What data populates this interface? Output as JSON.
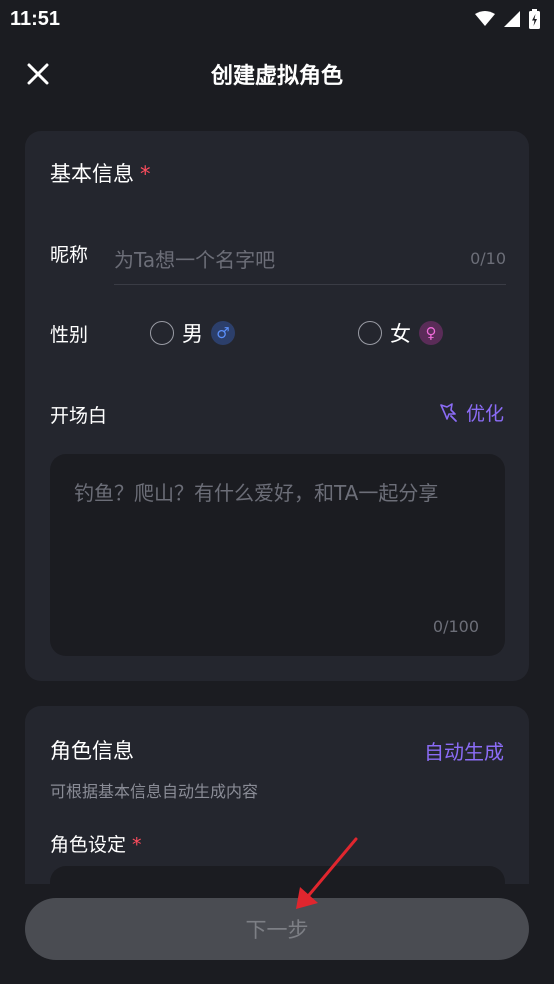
{
  "status_bar": {
    "time": "11:51",
    "icons": [
      "wifi-icon",
      "signal-icon",
      "battery-charging-icon"
    ]
  },
  "header": {
    "title": "创建虚拟角色",
    "close_icon": "close-icon"
  },
  "basic_info": {
    "title": "基本信息",
    "required_mark": "*",
    "nickname": {
      "label": "昵称",
      "placeholder": "为Ta想一个名字吧",
      "counter": "0/10"
    },
    "gender": {
      "label": "性别",
      "male_label": "男",
      "male_symbol": "♂",
      "female_label": "女",
      "female_symbol": "♀"
    },
    "opening": {
      "label": "开场白",
      "optimize_label": "优化",
      "optimize_icon": "magic-wand-icon",
      "placeholder": "钓鱼？爬山？有什么爱好，和TA一起分享",
      "counter": "0/100"
    }
  },
  "role_info": {
    "title": "角色信息",
    "auto_generate_label": "自动生成",
    "hint": "可根据基本信息自动生成内容",
    "setting_label": "角色设定",
    "required_mark": "*"
  },
  "footer": {
    "next_label": "下一步"
  },
  "colors": {
    "background": "#1b1c21",
    "card": "#24262e",
    "accent": "#8b6cf6",
    "required": "#ff4d5e",
    "annotation_arrow": "#e0262e"
  }
}
